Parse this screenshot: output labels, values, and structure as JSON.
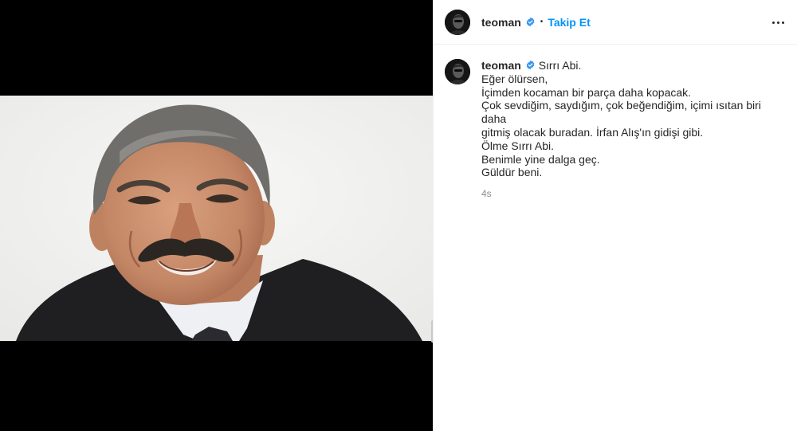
{
  "header": {
    "username": "teoman",
    "separator": "•",
    "follow_label": "Takip Et"
  },
  "icons": {
    "verified": "verified-badge-icon",
    "more": "more-options-icon",
    "verified_color": "#3897f0"
  },
  "colors": {
    "accent": "#0095f6",
    "text": "#262626",
    "muted": "#8e8e8e"
  },
  "caption": {
    "username": "teoman",
    "first_line": "Sırrı Abi.",
    "lines": [
      "Eğer ölürsen,",
      "İçimden kocaman bir parça daha kopacak.",
      "Çok sevdiğim, saydığım, çok beğendiğim, içimi ısıtan biri daha",
      "gitmiş olacak buradan. İrfan Alış'ın gidişi gibi.",
      "Ölme Sırrı Abi.",
      "Benimle yine dalga geç.",
      "Güldür beni."
    ],
    "timestamp": "4s"
  }
}
